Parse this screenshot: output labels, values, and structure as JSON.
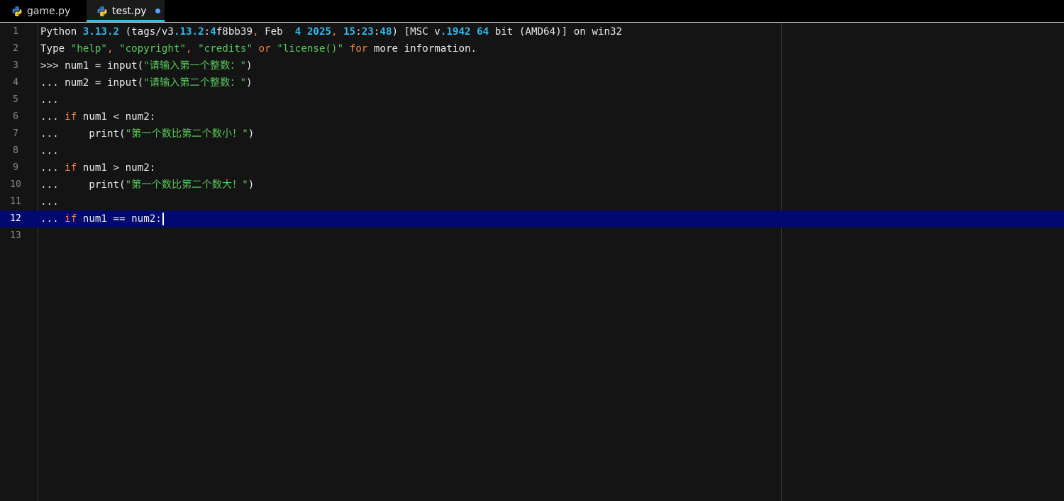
{
  "tabs": [
    {
      "label": "game.py",
      "icon": "python-file-icon",
      "active": false,
      "modified": false
    },
    {
      "label": "test.py",
      "icon": "python-file-icon",
      "active": true,
      "modified": true
    }
  ],
  "colors": {
    "keyword": "#f0823c",
    "number": "#2fb9ea",
    "string": "#57c85a",
    "current_line": "#000a6e",
    "tab_underline": "#21c7e6",
    "modified_dot": "#4ea3ff"
  },
  "editor": {
    "current_line": 12,
    "lines": [
      {
        "num": "1",
        "tokens": [
          {
            "t": "p",
            "v": "Python "
          },
          {
            "t": "n",
            "v": "3.13.2"
          },
          {
            "t": "p",
            "v": " (tags/v3"
          },
          {
            "t": "n",
            "v": ".13.2"
          },
          {
            "t": "p",
            "v": ":"
          },
          {
            "t": "n",
            "v": "4"
          },
          {
            "t": "p",
            "v": "f8bb39"
          },
          {
            "t": "k",
            "v": ","
          },
          {
            "t": "p",
            "v": " Feb  "
          },
          {
            "t": "n",
            "v": "4 2025"
          },
          {
            "t": "k",
            "v": ","
          },
          {
            "t": "p",
            "v": " "
          },
          {
            "t": "n",
            "v": "15"
          },
          {
            "t": "p",
            "v": ":"
          },
          {
            "t": "n",
            "v": "23"
          },
          {
            "t": "p",
            "v": ":"
          },
          {
            "t": "n",
            "v": "48"
          },
          {
            "t": "p",
            "v": ") [MSC v"
          },
          {
            "t": "n",
            "v": ".1942 64"
          },
          {
            "t": "p",
            "v": " bit (AMD64)] on win32"
          }
        ]
      },
      {
        "num": "2",
        "tokens": [
          {
            "t": "p",
            "v": "Type "
          },
          {
            "t": "s",
            "v": "\"help\""
          },
          {
            "t": "k",
            "v": ","
          },
          {
            "t": "p",
            "v": " "
          },
          {
            "t": "s",
            "v": "\"copyright\""
          },
          {
            "t": "k",
            "v": ","
          },
          {
            "t": "p",
            "v": " "
          },
          {
            "t": "s",
            "v": "\"credits\""
          },
          {
            "t": "p",
            "v": " "
          },
          {
            "t": "k",
            "v": "or"
          },
          {
            "t": "p",
            "v": " "
          },
          {
            "t": "s",
            "v": "\"license()\""
          },
          {
            "t": "p",
            "v": " "
          },
          {
            "t": "k",
            "v": "for"
          },
          {
            "t": "p",
            "v": " more information."
          }
        ]
      },
      {
        "num": "3",
        "tokens": [
          {
            "t": "p",
            "v": ">>> num1 = input("
          },
          {
            "t": "s",
            "v": "\"请输入第一个整数：\""
          },
          {
            "t": "p",
            "v": ")"
          }
        ]
      },
      {
        "num": "4",
        "tokens": [
          {
            "t": "p",
            "v": "... num2 = input("
          },
          {
            "t": "s",
            "v": "\"请输入第二个整数：\""
          },
          {
            "t": "p",
            "v": ")"
          }
        ]
      },
      {
        "num": "5",
        "tokens": [
          {
            "t": "p",
            "v": "..."
          }
        ]
      },
      {
        "num": "6",
        "tokens": [
          {
            "t": "p",
            "v": "... "
          },
          {
            "t": "k",
            "v": "if"
          },
          {
            "t": "p",
            "v": " num1 < num2:"
          }
        ]
      },
      {
        "num": "7",
        "tokens": [
          {
            "t": "p",
            "v": "...     print("
          },
          {
            "t": "s",
            "v": "\"第一个数比第二个数小！\""
          },
          {
            "t": "p",
            "v": ")"
          }
        ]
      },
      {
        "num": "8",
        "tokens": [
          {
            "t": "p",
            "v": "..."
          }
        ]
      },
      {
        "num": "9",
        "tokens": [
          {
            "t": "p",
            "v": "... "
          },
          {
            "t": "k",
            "v": "if"
          },
          {
            "t": "p",
            "v": " num1 > num2:"
          }
        ]
      },
      {
        "num": "10",
        "tokens": [
          {
            "t": "p",
            "v": "...     print("
          },
          {
            "t": "s",
            "v": "\"第一个数比第二个数大！\""
          },
          {
            "t": "p",
            "v": ")"
          }
        ]
      },
      {
        "num": "11",
        "tokens": [
          {
            "t": "p",
            "v": "..."
          }
        ]
      },
      {
        "num": "12",
        "tokens": [
          {
            "t": "p",
            "v": "... "
          },
          {
            "t": "k",
            "v": "if"
          },
          {
            "t": "p",
            "v": " num1 == num2:"
          }
        ]
      },
      {
        "num": "13",
        "tokens": []
      }
    ]
  }
}
